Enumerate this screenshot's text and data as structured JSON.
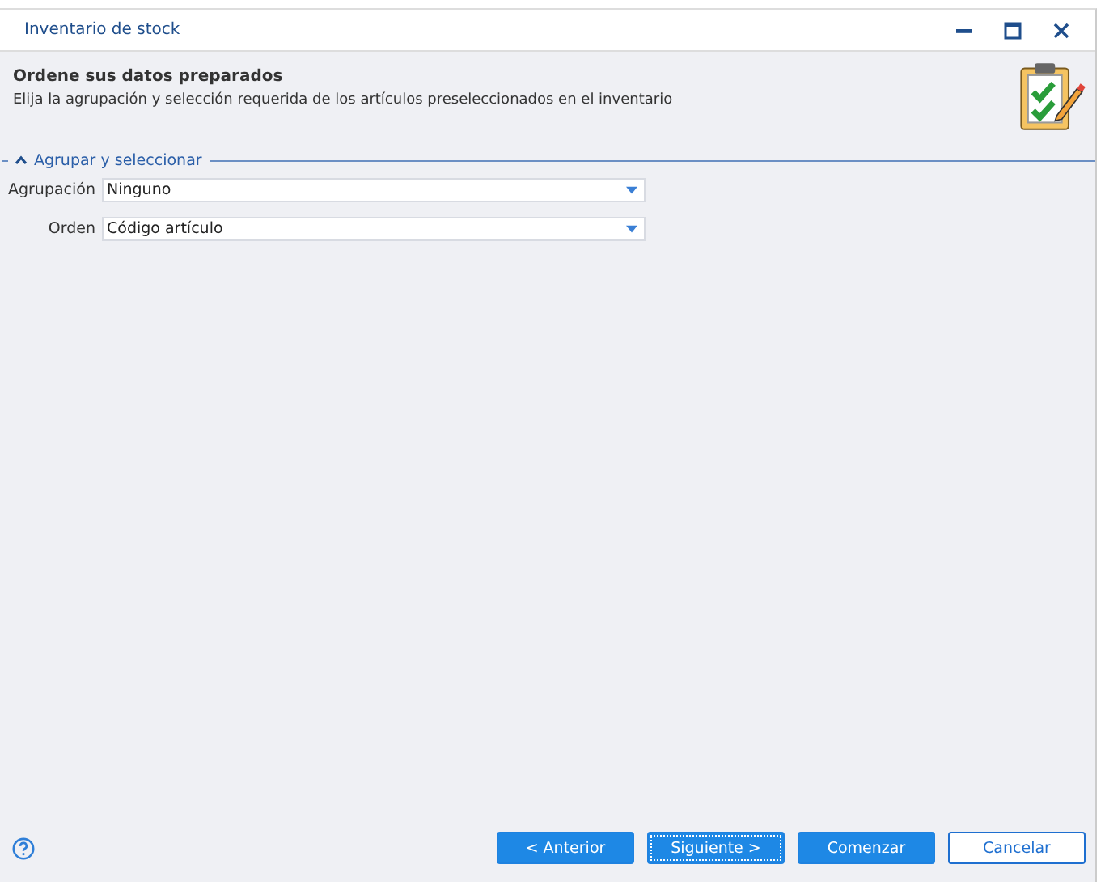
{
  "window": {
    "title": "Inventario de stock"
  },
  "header": {
    "title": "Ordene sus datos preparados",
    "subtitle": "Elija la agrupación y  selección requerida de los artículos preseleccionados en el inventario"
  },
  "section": {
    "title": "Agrupar y seleccionar",
    "expanded": true,
    "fields": [
      {
        "label": "Agrupación",
        "value": "Ninguno"
      },
      {
        "label": "Orden",
        "value": "Código artículo"
      }
    ]
  },
  "buttons": [
    {
      "label": "< Anterior",
      "kind": "primary",
      "focused": false
    },
    {
      "label": "Siguiente >",
      "kind": "primary",
      "focused": true
    },
    {
      "label": "Comenzar",
      "kind": "primary",
      "focused": false
    },
    {
      "label": "Cancelar",
      "kind": "outline",
      "focused": false
    }
  ]
}
